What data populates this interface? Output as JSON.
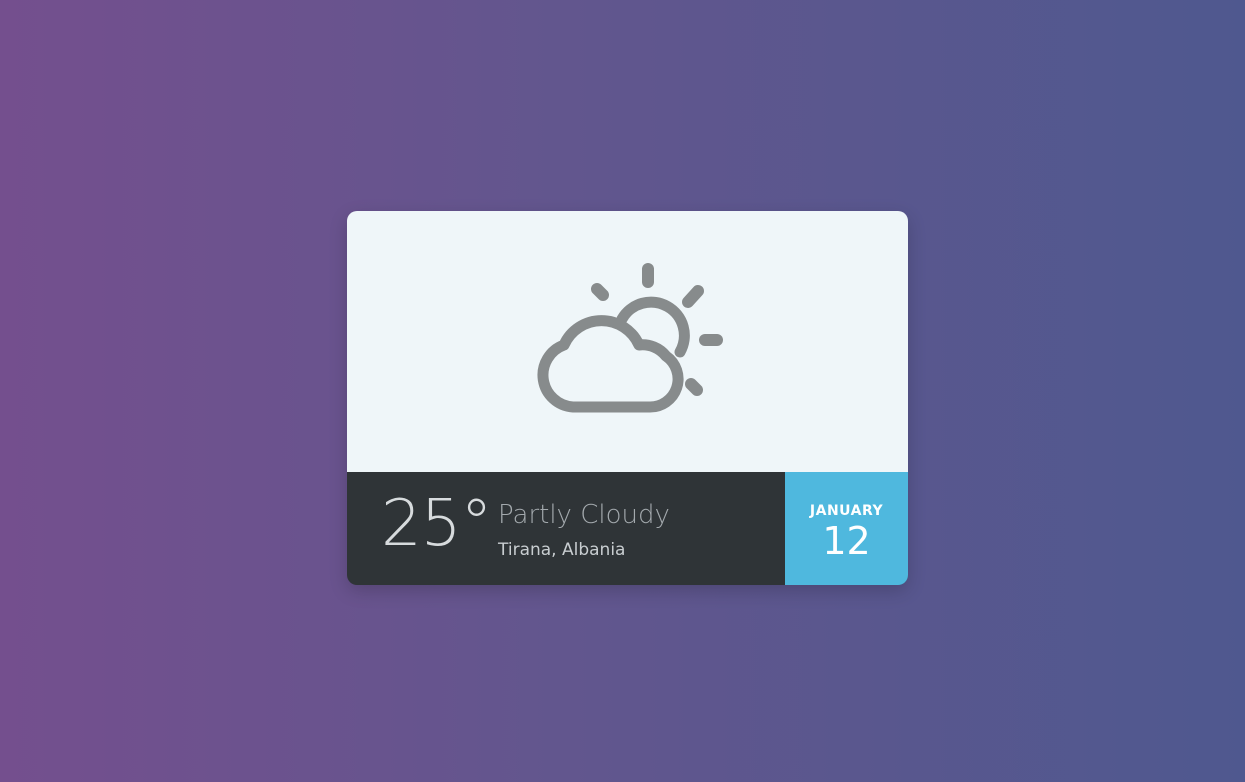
{
  "weather": {
    "icon": "partly-cloudy-icon",
    "temperature": "25°",
    "condition": "Partly Cloudy",
    "location": "Tirana, Albania"
  },
  "date": {
    "month": "JANUARY",
    "day": "12"
  },
  "colors": {
    "background_start": "#744f8e",
    "background_end": "#4f588f",
    "card_top": "#eff6f9",
    "card_bottom": "#2f3437",
    "date_accent": "#4fb8de",
    "icon": "#878b8c"
  }
}
